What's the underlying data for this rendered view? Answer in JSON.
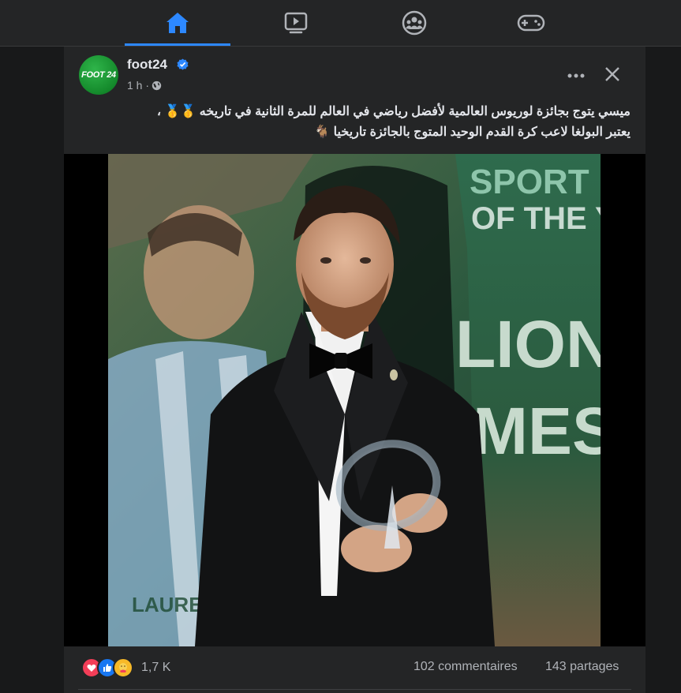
{
  "nav": {
    "tabs": [
      {
        "name": "home",
        "active": true
      },
      {
        "name": "watch",
        "active": false
      },
      {
        "name": "groups",
        "active": false
      },
      {
        "name": "gaming",
        "active": false
      }
    ],
    "accent": "#2d88ff"
  },
  "post": {
    "page_name": "foot24",
    "avatar_text": "FOOT 24",
    "time": "1 h ·",
    "privacy_icon": "globe-icon",
    "caption_line1": "ميسي يتوج بجائزة لوريوس العالمية لأفضل رياضي في العالم للمرة الثانية في تاريخه 🥇🥇 ،",
    "caption_line2": "يعتبر البولغا  لاعب كرة القدم الوحيد المتوج بالجائزة تاريخيا 🐐",
    "image_text": {
      "sportsman_line1": "SPORT",
      "sportsman_line2": "OF THE Y",
      "name_line1": "LIONE",
      "name_line2": "MESS",
      "shirt_text": "LAUREUS"
    },
    "reactions": [
      "love",
      "like",
      "care"
    ],
    "reaction_count": "1,7 K",
    "comments": "102 commentaires",
    "shares": "143 partages"
  }
}
